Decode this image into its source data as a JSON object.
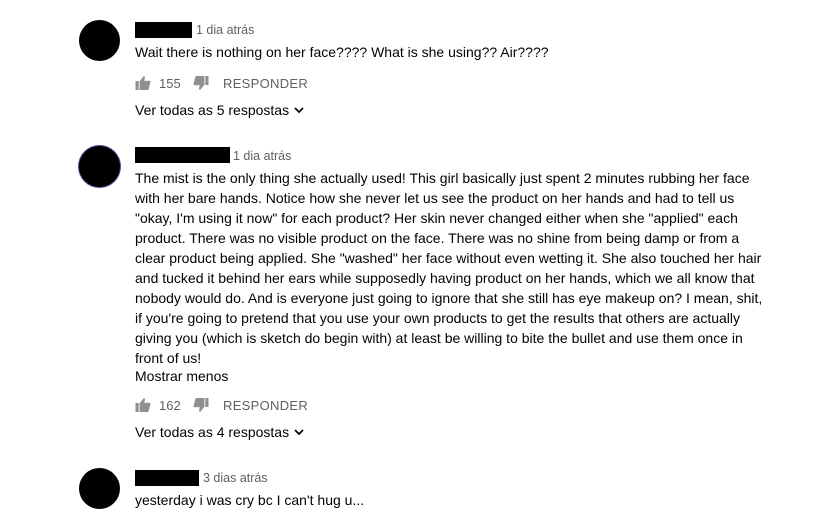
{
  "comments": [
    {
      "time": "1 dia atrás",
      "text": "Wait there is nothing on her face???? What is she using?? Air????",
      "likes": "155",
      "reply_label": "RESPONDER",
      "view_replies": "Ver todas as 5 respostas"
    },
    {
      "time": "1 dia atrás",
      "text": "The mist is the only thing she actually used! This girl basically just spent 2 minutes rubbing her face with her bare hands. Notice how she never let us see the product on her hands and had to tell us \"okay, I'm using it now\" for each product? Her skin never changed either when she \"applied\" each product. There was no visible product on the face. There was no shine from being damp or from a clear product being applied. She \"washed\" her face without even wetting it. She also touched her hair and tucked it behind her ears while supposedly having product on her hands, which we all know that nobody would do. And is everyone just going to ignore that she still has eye makeup on? I mean, shit, if you're going to pretend that you use your own products to get the results that others are actually giving you (which is sketch do begin with) at least be willing to bite the bullet and use them once in front of us!",
      "show_less": "Mostrar menos",
      "likes": "162",
      "reply_label": "RESPONDER",
      "view_replies": "Ver todas as 4 respostas"
    },
    {
      "time": "3 dias atrás",
      "text": "yesterday i was cry bc I can't hug u..."
    }
  ]
}
